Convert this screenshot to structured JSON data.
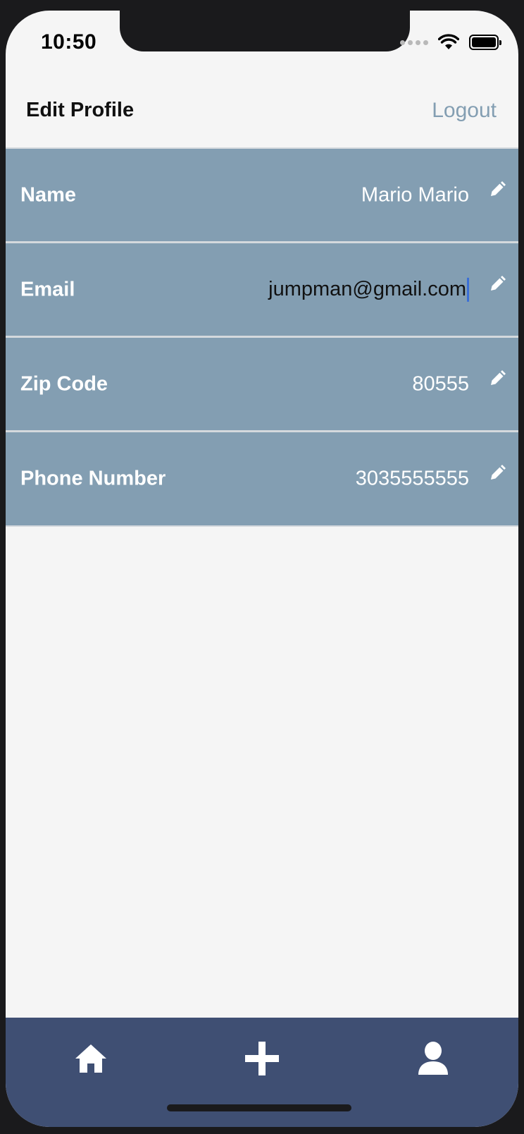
{
  "status_bar": {
    "time": "10:50"
  },
  "header": {
    "title": "Edit Profile",
    "logout_label": "Logout"
  },
  "profile_fields": [
    {
      "label": "Name",
      "value": "Mario Mario",
      "editing": false
    },
    {
      "label": "Email",
      "value": "jumpman@gmail.com",
      "editing": true
    },
    {
      "label": "Zip Code",
      "value": "80555",
      "editing": false
    },
    {
      "label": "Phone Number",
      "value": "3035555555",
      "editing": false
    }
  ],
  "tab_bar": {
    "items": [
      {
        "icon": "home-icon"
      },
      {
        "icon": "plus-icon"
      },
      {
        "icon": "user-icon"
      }
    ]
  },
  "colors": {
    "row_background": "#839eb2",
    "accent_link": "#839eb2",
    "tab_bar": "#3f4f73",
    "caret": "#3b6fd6"
  }
}
